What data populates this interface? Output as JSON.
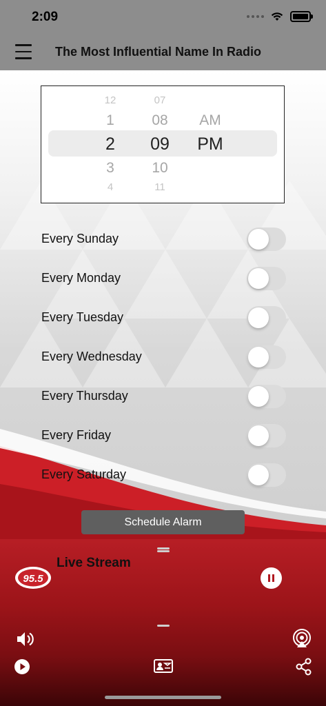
{
  "status_bar": {
    "time": "2:09"
  },
  "header": {
    "title": "The Most Influential Name In Radio"
  },
  "time_picker": {
    "hours": [
      "12",
      "1",
      "2",
      "3",
      "4"
    ],
    "minutes": [
      "07",
      "08",
      "09",
      "10",
      "11"
    ],
    "periods": [
      "AM",
      "PM"
    ],
    "selected": {
      "hour": "2",
      "minute": "09",
      "period": "PM"
    }
  },
  "alarm_days": [
    {
      "label": "Every Sunday",
      "enabled": false
    },
    {
      "label": "Every Monday",
      "enabled": false
    },
    {
      "label": "Every Tuesday",
      "enabled": false
    },
    {
      "label": "Every Wednesday",
      "enabled": false
    },
    {
      "label": "Every Thursday",
      "enabled": false
    },
    {
      "label": "Every Friday",
      "enabled": false
    },
    {
      "label": "Every Saturday",
      "enabled": false
    }
  ],
  "schedule_button": {
    "label": "Schedule Alarm"
  },
  "player": {
    "title": "Live Stream",
    "logo_text": "95.5",
    "state": "playing"
  },
  "bottom_toolbar": {
    "icons": [
      "volume-icon",
      "airplay-icon",
      "play-icon",
      "contact-card-icon",
      "share-icon"
    ]
  },
  "colors": {
    "header_gray": "#8d8d8d",
    "player_red": "#b71e25",
    "button_gray": "#5f5f5f"
  }
}
